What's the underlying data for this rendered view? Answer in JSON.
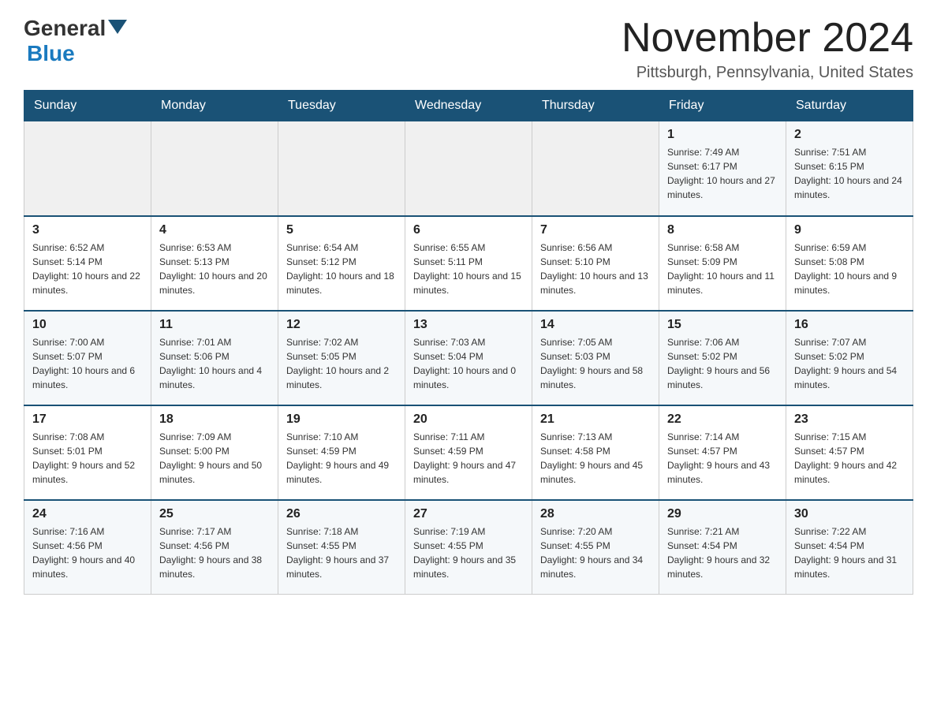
{
  "header": {
    "logo_general": "General",
    "logo_blue": "Blue",
    "title": "November 2024",
    "subtitle": "Pittsburgh, Pennsylvania, United States"
  },
  "days_of_week": [
    "Sunday",
    "Monday",
    "Tuesday",
    "Wednesday",
    "Thursday",
    "Friday",
    "Saturday"
  ],
  "weeks": [
    [
      {
        "day": "",
        "sunrise": "",
        "sunset": "",
        "daylight": ""
      },
      {
        "day": "",
        "sunrise": "",
        "sunset": "",
        "daylight": ""
      },
      {
        "day": "",
        "sunrise": "",
        "sunset": "",
        "daylight": ""
      },
      {
        "day": "",
        "sunrise": "",
        "sunset": "",
        "daylight": ""
      },
      {
        "day": "",
        "sunrise": "",
        "sunset": "",
        "daylight": ""
      },
      {
        "day": "1",
        "sunrise": "Sunrise: 7:49 AM",
        "sunset": "Sunset: 6:17 PM",
        "daylight": "Daylight: 10 hours and 27 minutes."
      },
      {
        "day": "2",
        "sunrise": "Sunrise: 7:51 AM",
        "sunset": "Sunset: 6:15 PM",
        "daylight": "Daylight: 10 hours and 24 minutes."
      }
    ],
    [
      {
        "day": "3",
        "sunrise": "Sunrise: 6:52 AM",
        "sunset": "Sunset: 5:14 PM",
        "daylight": "Daylight: 10 hours and 22 minutes."
      },
      {
        "day": "4",
        "sunrise": "Sunrise: 6:53 AM",
        "sunset": "Sunset: 5:13 PM",
        "daylight": "Daylight: 10 hours and 20 minutes."
      },
      {
        "day": "5",
        "sunrise": "Sunrise: 6:54 AM",
        "sunset": "Sunset: 5:12 PM",
        "daylight": "Daylight: 10 hours and 18 minutes."
      },
      {
        "day": "6",
        "sunrise": "Sunrise: 6:55 AM",
        "sunset": "Sunset: 5:11 PM",
        "daylight": "Daylight: 10 hours and 15 minutes."
      },
      {
        "day": "7",
        "sunrise": "Sunrise: 6:56 AM",
        "sunset": "Sunset: 5:10 PM",
        "daylight": "Daylight: 10 hours and 13 minutes."
      },
      {
        "day": "8",
        "sunrise": "Sunrise: 6:58 AM",
        "sunset": "Sunset: 5:09 PM",
        "daylight": "Daylight: 10 hours and 11 minutes."
      },
      {
        "day": "9",
        "sunrise": "Sunrise: 6:59 AM",
        "sunset": "Sunset: 5:08 PM",
        "daylight": "Daylight: 10 hours and 9 minutes."
      }
    ],
    [
      {
        "day": "10",
        "sunrise": "Sunrise: 7:00 AM",
        "sunset": "Sunset: 5:07 PM",
        "daylight": "Daylight: 10 hours and 6 minutes."
      },
      {
        "day": "11",
        "sunrise": "Sunrise: 7:01 AM",
        "sunset": "Sunset: 5:06 PM",
        "daylight": "Daylight: 10 hours and 4 minutes."
      },
      {
        "day": "12",
        "sunrise": "Sunrise: 7:02 AM",
        "sunset": "Sunset: 5:05 PM",
        "daylight": "Daylight: 10 hours and 2 minutes."
      },
      {
        "day": "13",
        "sunrise": "Sunrise: 7:03 AM",
        "sunset": "Sunset: 5:04 PM",
        "daylight": "Daylight: 10 hours and 0 minutes."
      },
      {
        "day": "14",
        "sunrise": "Sunrise: 7:05 AM",
        "sunset": "Sunset: 5:03 PM",
        "daylight": "Daylight: 9 hours and 58 minutes."
      },
      {
        "day": "15",
        "sunrise": "Sunrise: 7:06 AM",
        "sunset": "Sunset: 5:02 PM",
        "daylight": "Daylight: 9 hours and 56 minutes."
      },
      {
        "day": "16",
        "sunrise": "Sunrise: 7:07 AM",
        "sunset": "Sunset: 5:02 PM",
        "daylight": "Daylight: 9 hours and 54 minutes."
      }
    ],
    [
      {
        "day": "17",
        "sunrise": "Sunrise: 7:08 AM",
        "sunset": "Sunset: 5:01 PM",
        "daylight": "Daylight: 9 hours and 52 minutes."
      },
      {
        "day": "18",
        "sunrise": "Sunrise: 7:09 AM",
        "sunset": "Sunset: 5:00 PM",
        "daylight": "Daylight: 9 hours and 50 minutes."
      },
      {
        "day": "19",
        "sunrise": "Sunrise: 7:10 AM",
        "sunset": "Sunset: 4:59 PM",
        "daylight": "Daylight: 9 hours and 49 minutes."
      },
      {
        "day": "20",
        "sunrise": "Sunrise: 7:11 AM",
        "sunset": "Sunset: 4:59 PM",
        "daylight": "Daylight: 9 hours and 47 minutes."
      },
      {
        "day": "21",
        "sunrise": "Sunrise: 7:13 AM",
        "sunset": "Sunset: 4:58 PM",
        "daylight": "Daylight: 9 hours and 45 minutes."
      },
      {
        "day": "22",
        "sunrise": "Sunrise: 7:14 AM",
        "sunset": "Sunset: 4:57 PM",
        "daylight": "Daylight: 9 hours and 43 minutes."
      },
      {
        "day": "23",
        "sunrise": "Sunrise: 7:15 AM",
        "sunset": "Sunset: 4:57 PM",
        "daylight": "Daylight: 9 hours and 42 minutes."
      }
    ],
    [
      {
        "day": "24",
        "sunrise": "Sunrise: 7:16 AM",
        "sunset": "Sunset: 4:56 PM",
        "daylight": "Daylight: 9 hours and 40 minutes."
      },
      {
        "day": "25",
        "sunrise": "Sunrise: 7:17 AM",
        "sunset": "Sunset: 4:56 PM",
        "daylight": "Daylight: 9 hours and 38 minutes."
      },
      {
        "day": "26",
        "sunrise": "Sunrise: 7:18 AM",
        "sunset": "Sunset: 4:55 PM",
        "daylight": "Daylight: 9 hours and 37 minutes."
      },
      {
        "day": "27",
        "sunrise": "Sunrise: 7:19 AM",
        "sunset": "Sunset: 4:55 PM",
        "daylight": "Daylight: 9 hours and 35 minutes."
      },
      {
        "day": "28",
        "sunrise": "Sunrise: 7:20 AM",
        "sunset": "Sunset: 4:55 PM",
        "daylight": "Daylight: 9 hours and 34 minutes."
      },
      {
        "day": "29",
        "sunrise": "Sunrise: 7:21 AM",
        "sunset": "Sunset: 4:54 PM",
        "daylight": "Daylight: 9 hours and 32 minutes."
      },
      {
        "day": "30",
        "sunrise": "Sunrise: 7:22 AM",
        "sunset": "Sunset: 4:54 PM",
        "daylight": "Daylight: 9 hours and 31 minutes."
      }
    ]
  ]
}
